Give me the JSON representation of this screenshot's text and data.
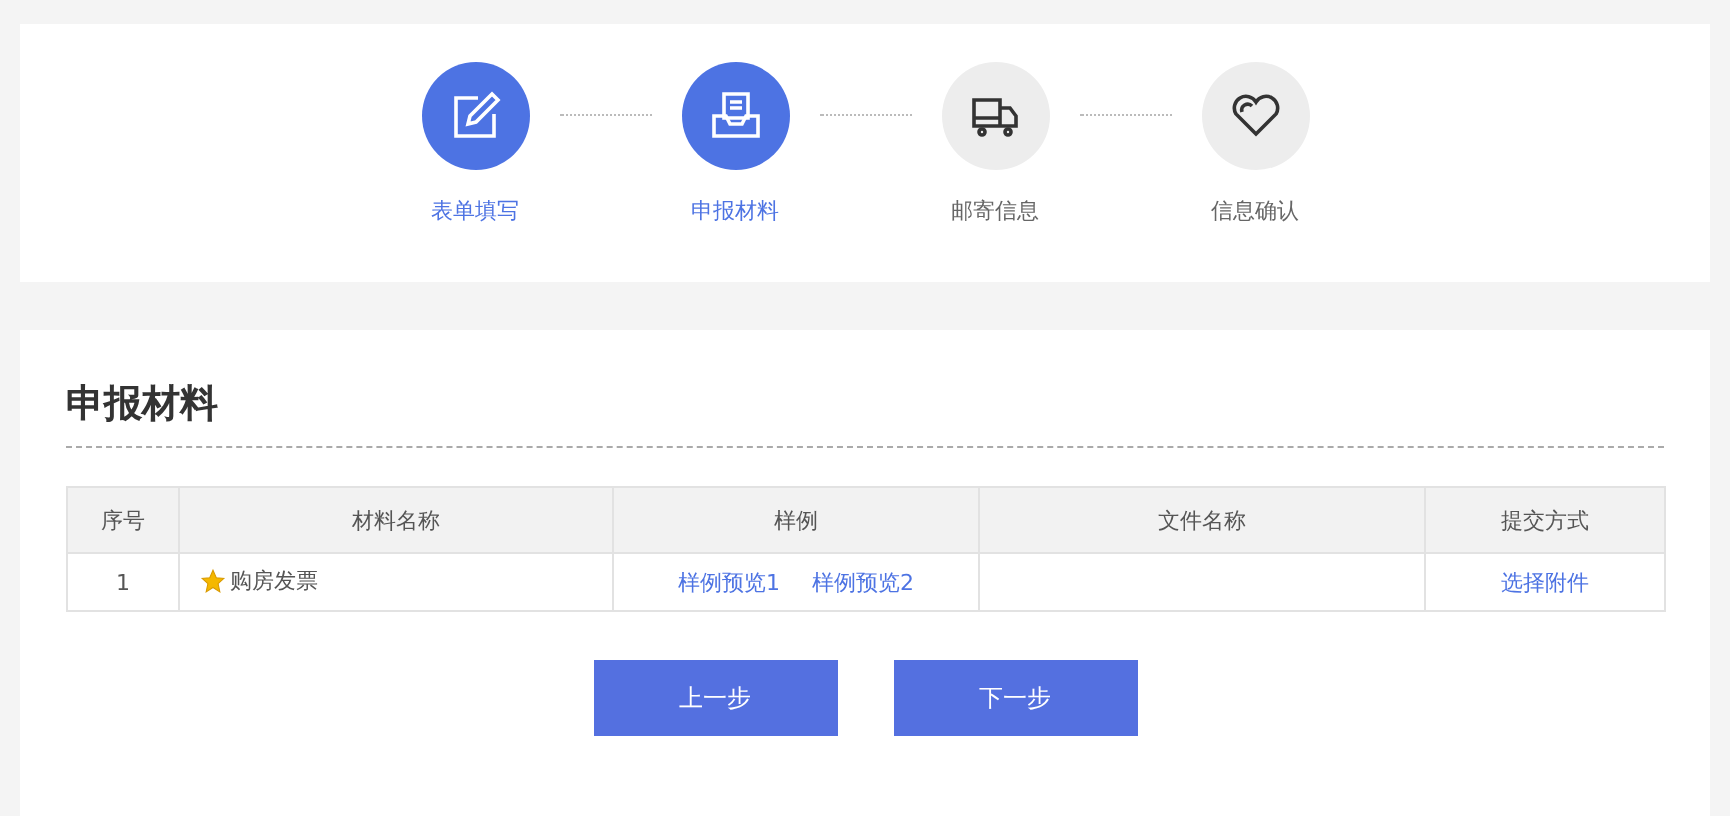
{
  "steps": [
    {
      "label": "表单填写",
      "selected": true
    },
    {
      "label": "申报材料",
      "selected": true
    },
    {
      "label": "邮寄信息",
      "selected": false
    },
    {
      "label": "信息确认",
      "selected": false
    }
  ],
  "section_title": "申报材料",
  "table": {
    "columns": [
      "序号",
      "材料名称",
      "样例",
      "文件名称",
      "提交方式"
    ],
    "rows": [
      {
        "index": "1",
        "name": "购房发票",
        "required": true,
        "samples": [
          "样例预览1",
          "样例预览2"
        ],
        "submit": "选择附件"
      }
    ]
  },
  "buttons": [
    "上一步",
    "下一步"
  ]
}
